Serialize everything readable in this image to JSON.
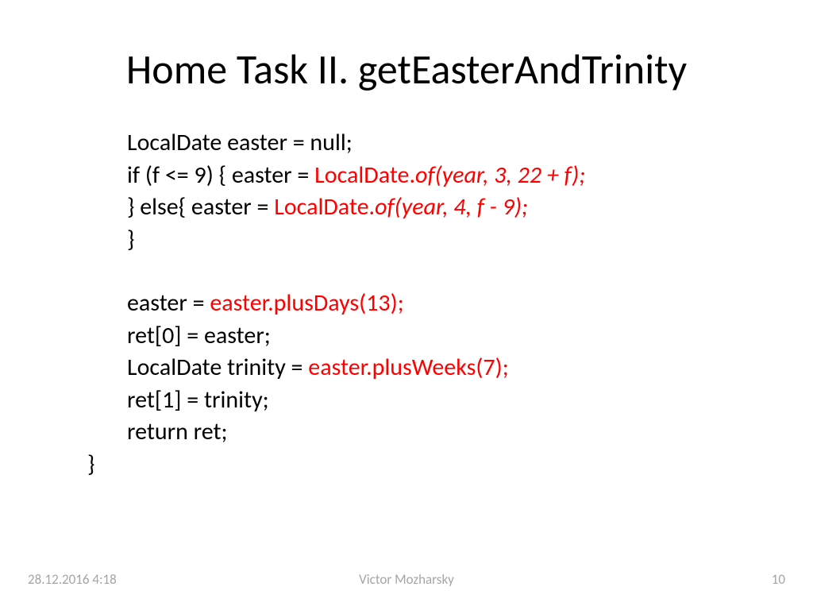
{
  "title": "Home Task II. getEasterAndTrinity",
  "code": {
    "l1a": "LocalDate easter = null;",
    "l2a": "if (f <= 9) { easter = ",
    "l2b": "LocalDate.",
    "l2c": "of(year, 3, 22 + f);",
    "l3a": "} else{ easter = ",
    "l3b": "LocalDate.",
    "l3c": "of(year, 4, f - 9);",
    "l4a": "}",
    "l5a": "easter = ",
    "l5b": "easter.plusDays(13);",
    "l6a": "ret[0] = easter;",
    "l7a": "LocalDate trinity = ",
    "l7b": "easter.plusWeeks(7);",
    "l8a": "ret[1] = trinity;",
    "l9a": "return ret;",
    "l10a": "}"
  },
  "footer": {
    "date": "28.12.2016 4:18",
    "author": "Victor Mozharsky",
    "page": "10"
  }
}
